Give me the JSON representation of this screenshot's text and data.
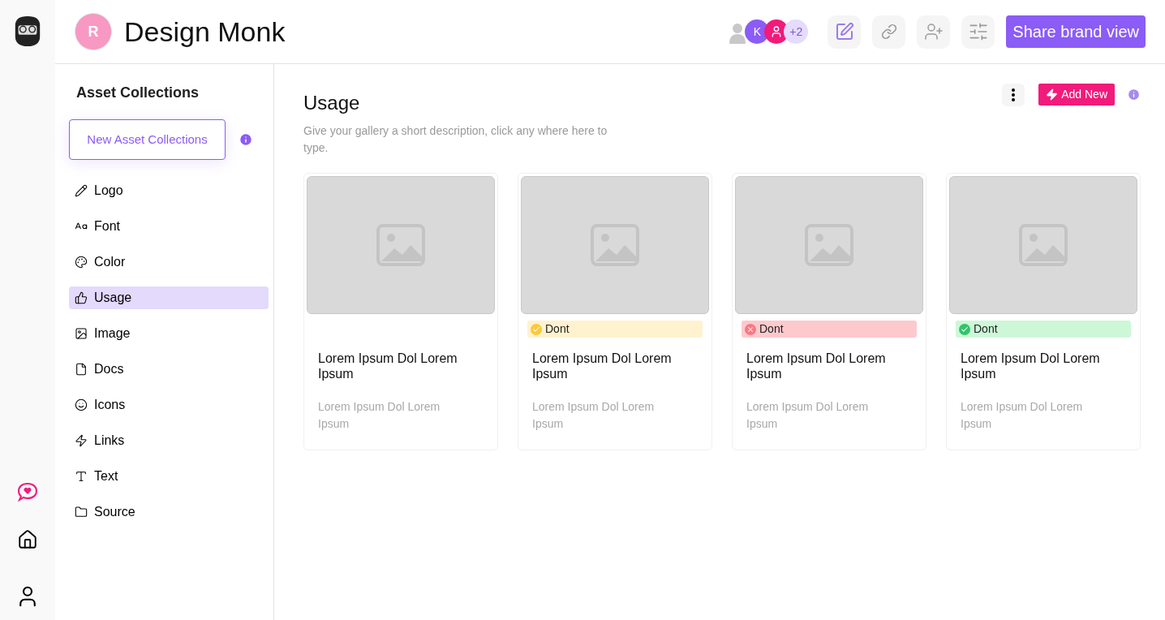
{
  "header": {
    "workspace_initial": "R",
    "title": "Design Monk",
    "avatars": [
      {
        "kind": "silhouette"
      },
      {
        "kind": "letter",
        "label": "K"
      },
      {
        "kind": "user"
      },
      {
        "kind": "count",
        "label": "+2"
      }
    ],
    "share_button": "Share brand view"
  },
  "sidebar": {
    "heading": "Asset Collections",
    "new_button": "New Asset Collections",
    "items": [
      {
        "label": "Logo",
        "selected": false
      },
      {
        "label": "Font",
        "selected": false
      },
      {
        "label": "Color",
        "selected": false
      },
      {
        "label": "Usage",
        "selected": true
      },
      {
        "label": "Image",
        "selected": false
      },
      {
        "label": "Docs",
        "selected": false
      },
      {
        "label": "Icons",
        "selected": false
      },
      {
        "label": "Links",
        "selected": false
      },
      {
        "label": "Text",
        "selected": false
      },
      {
        "label": "Source",
        "selected": false
      }
    ]
  },
  "main": {
    "title": "Usage",
    "description": "Give your gallery a short description, click any where here to type.",
    "add_button": "Add New",
    "cards": [
      {
        "title": "Lorem Ipsum Dol Lorem Ipsum",
        "subtitle": "Lorem Ipsum Dol Lorem Ipsum"
      },
      {
        "badge": {
          "kind": "caution",
          "label": "Dont"
        },
        "title": "Lorem Ipsum Dol Lorem Ipsum",
        "subtitle": "Lorem Ipsum Dol Lorem Ipsum"
      },
      {
        "badge": {
          "kind": "error",
          "label": "Dont"
        },
        "title": "Lorem Ipsum Dol Lorem Ipsum",
        "subtitle": "Lorem Ipsum Dol Lorem Ipsum"
      },
      {
        "badge": {
          "kind": "success",
          "label": "Dont"
        },
        "title": "Lorem Ipsum Dol Lorem Ipsum",
        "subtitle": "Lorem Ipsum Dol Lorem Ipsum"
      }
    ]
  }
}
